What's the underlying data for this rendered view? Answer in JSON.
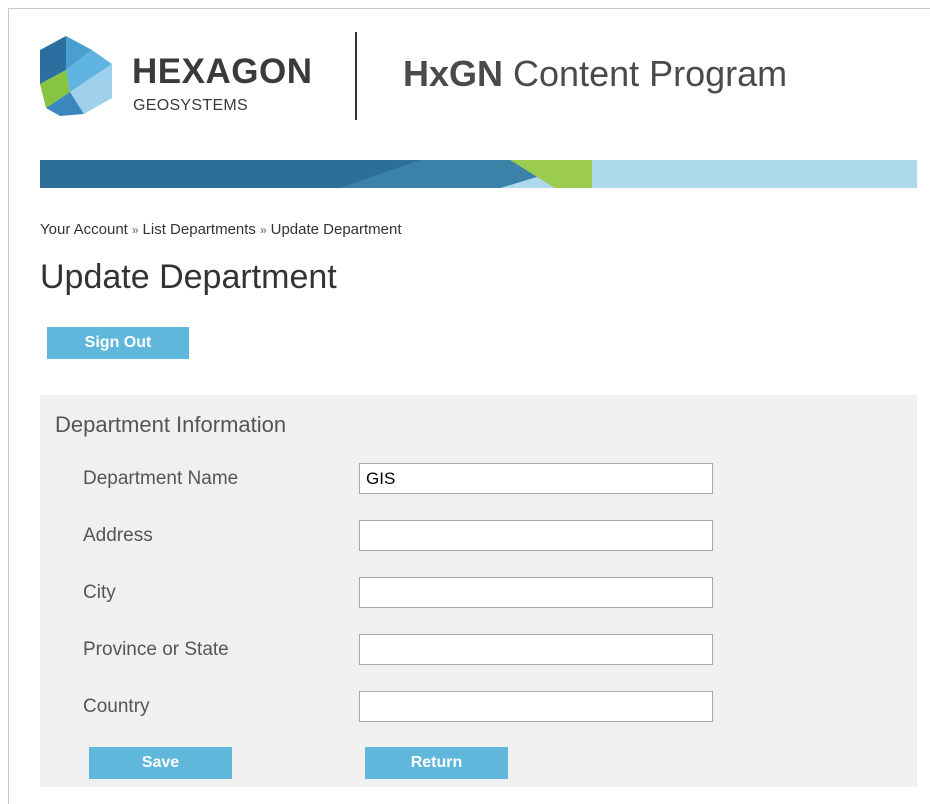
{
  "brand": {
    "name": "HEXAGON",
    "subname": "GEOSYSTEMS",
    "program_bold": "HxGN",
    "program_rest": " Content Program"
  },
  "breadcrumb": {
    "items": [
      "Your Account",
      "List Departments",
      "Update Department"
    ],
    "separator": "»"
  },
  "page": {
    "title": "Update Department",
    "sign_out_label": "Sign Out"
  },
  "form": {
    "section_title": "Department Information",
    "fields": [
      {
        "label": "Department Name",
        "value": "GIS"
      },
      {
        "label": "Address",
        "value": ""
      },
      {
        "label": "City",
        "value": ""
      },
      {
        "label": "Province or State",
        "value": ""
      },
      {
        "label": "Country",
        "value": ""
      }
    ],
    "save_label": "Save",
    "return_label": "Return"
  },
  "colors": {
    "button": "#5fb7dc",
    "banner_dark": "#2e6f98",
    "banner_green": "#9ccc4f",
    "banner_light": "#aed8eb",
    "panel": "#f0f0f0"
  },
  "icons": {
    "logo": "hexagon-logo-icon"
  }
}
